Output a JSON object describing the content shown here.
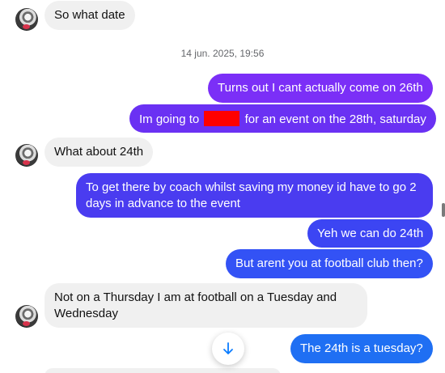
{
  "conversation": {
    "timestamp": "14 jun. 2025, 19:56",
    "messages": [
      {
        "id": "m1",
        "direction": "incoming",
        "text": "So what date"
      },
      {
        "id": "m2",
        "direction": "outgoing",
        "text": "Turns out I cant actually come on 26th"
      },
      {
        "id": "m3",
        "direction": "outgoing",
        "text_before": "Im going to",
        "text_after": "for an event on the 28th, saturday",
        "redaction_color": "#ff0000"
      },
      {
        "id": "m4",
        "direction": "incoming",
        "text": "What about 24th"
      },
      {
        "id": "m5",
        "direction": "outgoing",
        "text": "To get there by coach whilst saving my money id have to go 2 days in advance to the event"
      },
      {
        "id": "m6",
        "direction": "outgoing",
        "text": "Yeh we can do 24th"
      },
      {
        "id": "m7",
        "direction": "outgoing",
        "text": "But arent you at football club then?"
      },
      {
        "id": "m8",
        "direction": "incoming",
        "text": "Not on a Thursday I am at football on a Tuesday and Wednesday"
      },
      {
        "id": "m9",
        "direction": "outgoing",
        "text": "The 24th is a tuesday?"
      }
    ]
  },
  "colors": {
    "incoming_bubble": "#f0f0f0",
    "outgoing_gradient": [
      "#7b2ff7",
      "#6633f0",
      "#4a3cf0",
      "#3c4cf5",
      "#2f63f5",
      "#1f79f2"
    ],
    "accent_blue": "#0a7cff"
  },
  "icons": {
    "scroll_down": "arrow-down-icon"
  }
}
